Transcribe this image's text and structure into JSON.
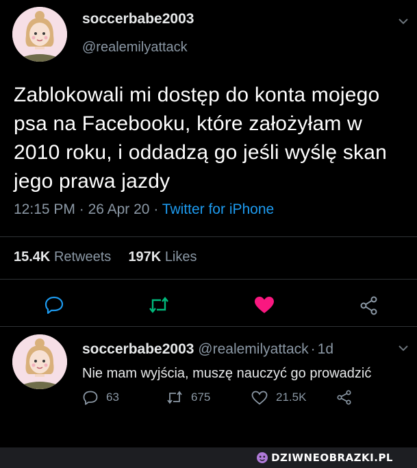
{
  "tweet": {
    "display_name": "soccerbabe2003",
    "handle": "@realemilyattack",
    "text": "Zablokowali mi dostęp do konta mojego psa na Facebooku, które założyłam w 2010 roku, i oddadzą go jeśli wyślę skan jego prawa jazdy",
    "time": "12:15 PM",
    "date": "26 Apr 20",
    "separator": "·",
    "source": "Twitter for iPhone",
    "retweets_count": "15.4K",
    "retweets_label": "Retweets",
    "likes_count": "197K",
    "likes_label": "Likes"
  },
  "actions": [
    {
      "icon": "reply-icon",
      "color": "#1d9bf0"
    },
    {
      "icon": "retweet-icon",
      "color": "#00ba7c"
    },
    {
      "icon": "heart-icon",
      "color": "#f91880"
    },
    {
      "icon": "share-icon",
      "color": "#8b98a5"
    }
  ],
  "reply": {
    "display_name": "soccerbabe2003",
    "handle": "@realemilyattack",
    "separator": "·",
    "age": "1d",
    "text": "Nie mam wyjścia, muszę nauczyć go prowadzić",
    "replies": "63",
    "retweets": "675",
    "likes": "21.5K"
  },
  "watermark": {
    "text": "DZIWNEOBRAZKI.PL"
  },
  "colors": {
    "background": "#000000",
    "muted": "#8b98a5",
    "link": "#1d9bf0",
    "retweet": "#00ba7c",
    "like": "#f91880"
  }
}
